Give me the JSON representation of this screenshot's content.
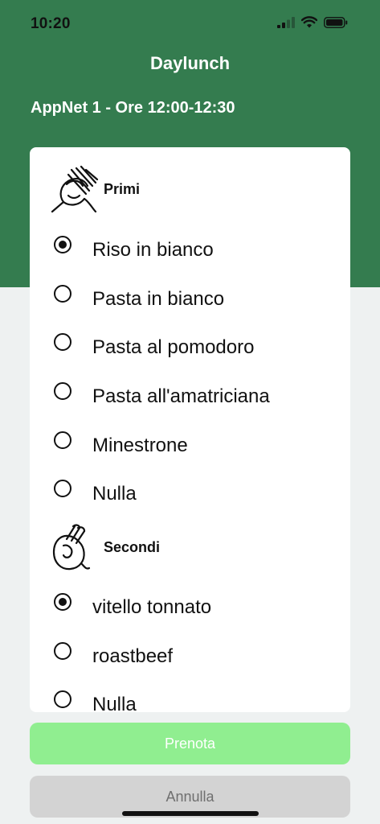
{
  "status_bar": {
    "time": "10:20"
  },
  "header": {
    "title": "Daylunch",
    "subtitle": "AppNet 1 - Ore 12:00-12:30",
    "color": "#347c4f"
  },
  "sections": [
    {
      "label": "Primi",
      "icon": "pasta-icon",
      "options": [
        {
          "label": "Riso in bianco",
          "selected": true
        },
        {
          "label": "Pasta in bianco",
          "selected": false
        },
        {
          "label": "Pasta al pomodoro",
          "selected": false
        },
        {
          "label": "Pasta all'amatriciana",
          "selected": false
        },
        {
          "label": "Minestrone",
          "selected": false
        },
        {
          "label": "Nulla",
          "selected": false
        }
      ]
    },
    {
      "label": "Secondi",
      "icon": "meat-icon",
      "options": [
        {
          "label": "vitello tonnato",
          "selected": true
        },
        {
          "label": "roastbeef",
          "selected": false
        },
        {
          "label": "Nulla",
          "selected": false
        }
      ]
    }
  ],
  "actions": {
    "book_label": "Prenota",
    "cancel_label": "Annulla",
    "book_color": "#90ee90",
    "cancel_color": "#d3d3d3"
  }
}
